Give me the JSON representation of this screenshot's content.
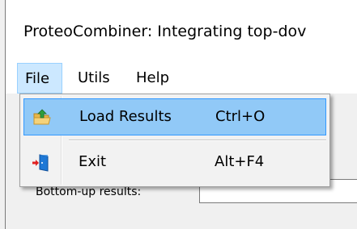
{
  "window": {
    "title": "ProteoCombiner: Integrating top-dov"
  },
  "menubar": {
    "items": [
      {
        "label": "File",
        "active": true
      },
      {
        "label": "Utils",
        "active": false
      },
      {
        "label": "Help",
        "active": false
      }
    ]
  },
  "file_menu": {
    "items": [
      {
        "label": "Load Results",
        "shortcut": "Ctrl+O",
        "icon": "folder-open-icon",
        "highlighted": true
      },
      {
        "label": "Exit",
        "shortcut": "Alt+F4",
        "icon": "exit-door-icon",
        "highlighted": false
      }
    ]
  },
  "background": {
    "label": "Bottom-up results:"
  },
  "colors": {
    "menu_highlight": "#91c9f7",
    "menu_highlight_border": "#3399ff",
    "menubar_active": "#cce8ff"
  }
}
